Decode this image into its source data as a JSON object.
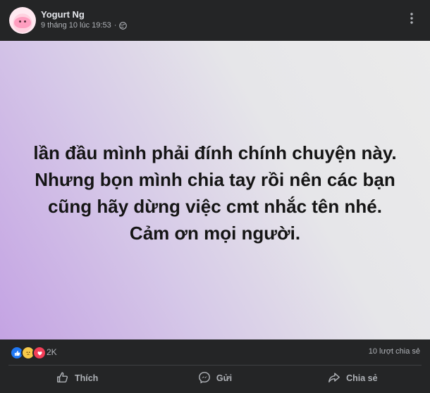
{
  "post": {
    "author": "Yogurt Ng",
    "timestamp": "9 tháng 10 lúc 19:53",
    "separator": "·",
    "privacy_icon": "globe-icon",
    "more_icon": "more-dots-icon",
    "text": "lần đầu mình phải đính chính chuyện này. Nhưng bọn mình chia tay rồi nên các bạn cũng hãy dừng việc cmt nhắc tên nhé. Cảm ơn mọi người.",
    "background_colors": [
      "#c4a3e3",
      "#ebebeb"
    ]
  },
  "reactions": {
    "icons": [
      "like-icon",
      "sad-icon",
      "love-icon"
    ],
    "count": "2K",
    "shares": "10 lượt chia sẻ"
  },
  "actions": {
    "like": "Thích",
    "comment": "Gửi",
    "share": "Chia sẻ"
  }
}
